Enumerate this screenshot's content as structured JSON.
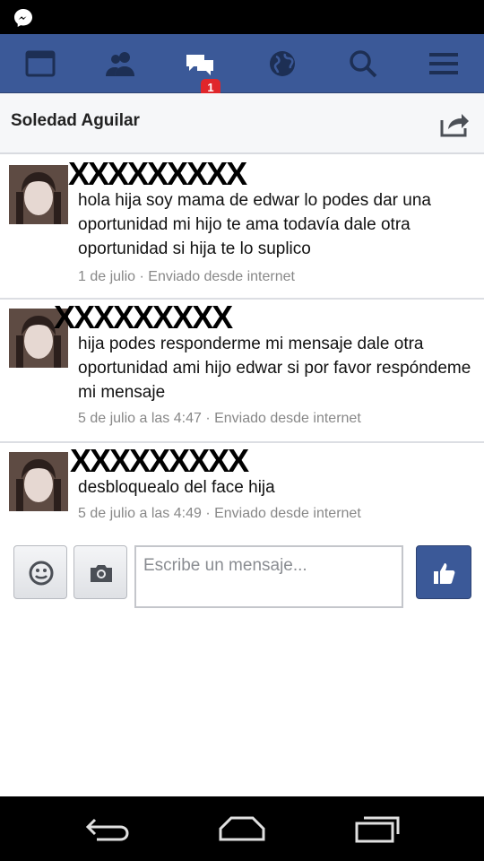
{
  "status_bar": {
    "icon": "messenger-icon"
  },
  "nav": {
    "icons": [
      "news-feed-icon",
      "friend-requests-icon",
      "messages-icon",
      "notifications-globe-icon",
      "search-icon",
      "menu-icon"
    ],
    "messages_badge": "1",
    "brand_color": "#3b5998"
  },
  "conversation": {
    "title": "Soledad Aguilar",
    "share_icon": "share-icon"
  },
  "messages": [
    {
      "sender": "XXXXXXXXX",
      "text": "hola hija soy mama de edwar lo podes dar una oportunidad mi hijo te ama todavía dale otra oportunidad si hija te lo suplico",
      "meta": "1 de julio · Enviado desde internet"
    },
    {
      "sender": "XXXXXXXXX",
      "text": "hija podes responderme mi mensaje dale otra oportunidad ami hijo edwar si por favor respóndeme mi mensaje",
      "meta": "5 de julio a las 4:47 · Enviado desde internet"
    },
    {
      "sender": "XXXXXXXXX",
      "text": "desbloquealo del face hija",
      "meta": "5 de julio a las 4:49 · Enviado desde internet"
    }
  ],
  "composer": {
    "placeholder": "Escribe un mensaje...",
    "emoji_icon": "emoji-icon",
    "camera_icon": "camera-icon",
    "like_icon": "thumbs-up-icon"
  },
  "system_nav": [
    "back-icon",
    "home-icon",
    "recents-icon"
  ]
}
